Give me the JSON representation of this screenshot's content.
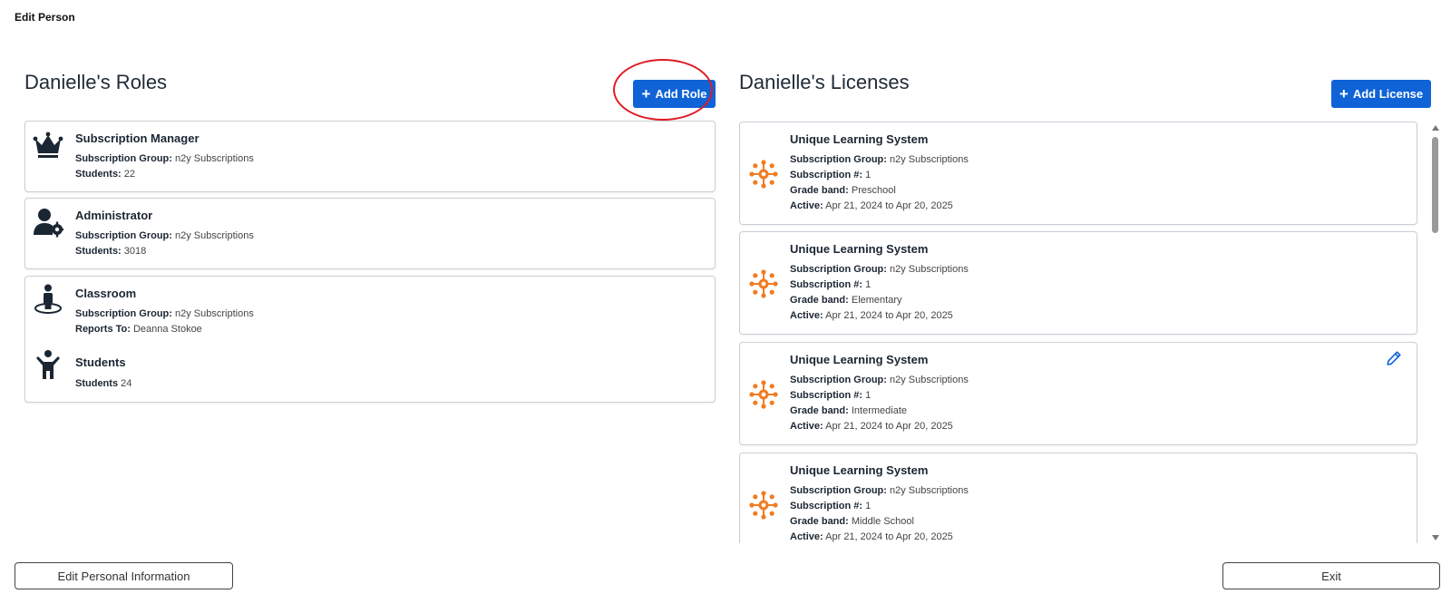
{
  "header": {
    "title": "Edit Person"
  },
  "roles": {
    "title": "Danielle's Roles",
    "add_label": "Add Role",
    "cards": [
      {
        "entries": [
          {
            "icon": "crown-icon",
            "title": "Subscription Manager",
            "lines": [
              {
                "label": "Subscription Group:",
                "value": "n2y Subscriptions"
              },
              {
                "label": "Students:",
                "value": "22"
              }
            ]
          }
        ]
      },
      {
        "entries": [
          {
            "icon": "user-gear-icon",
            "title": "Administrator",
            "lines": [
              {
                "label": "Subscription Group:",
                "value": "n2y Subscriptions"
              },
              {
                "label": "Students:",
                "value": "3018"
              }
            ]
          }
        ]
      },
      {
        "entries": [
          {
            "icon": "person-circle-icon",
            "title": "Classroom",
            "lines": [
              {
                "label": "Subscription Group:",
                "value": "n2y Subscriptions"
              },
              {
                "label": "Reports To:",
                "value": "Deanna Stokoe"
              }
            ]
          },
          {
            "icon": "child-icon",
            "title": "Students",
            "lines": [
              {
                "label": "Students",
                "value": "24"
              }
            ]
          }
        ]
      }
    ]
  },
  "licenses": {
    "title": "Danielle's Licenses",
    "add_label": "Add License",
    "items": [
      {
        "title": "Unique Learning System",
        "lines": [
          {
            "label": "Subscription Group:",
            "value": "n2y Subscriptions"
          },
          {
            "label": "Subscription #:",
            "value": "1"
          },
          {
            "label": "Grade band:",
            "value": "Preschool"
          },
          {
            "label": "Active:",
            "value": "Apr 21, 2024 to Apr 20, 2025"
          }
        ]
      },
      {
        "title": "Unique Learning System",
        "lines": [
          {
            "label": "Subscription Group:",
            "value": "n2y Subscriptions"
          },
          {
            "label": "Subscription #:",
            "value": "1"
          },
          {
            "label": "Grade band:",
            "value": "Elementary"
          },
          {
            "label": "Active:",
            "value": "Apr 21, 2024 to Apr 20, 2025"
          }
        ]
      },
      {
        "title": "Unique Learning System",
        "editable": true,
        "lines": [
          {
            "label": "Subscription Group:",
            "value": "n2y Subscriptions"
          },
          {
            "label": "Subscription #:",
            "value": "1"
          },
          {
            "label": "Grade band:",
            "value": "Intermediate"
          },
          {
            "label": "Active:",
            "value": "Apr 21, 2024 to Apr 20, 2025"
          }
        ]
      },
      {
        "title": "Unique Learning System",
        "lines": [
          {
            "label": "Subscription Group:",
            "value": "n2y Subscriptions"
          },
          {
            "label": "Subscription #:",
            "value": "1"
          },
          {
            "label": "Grade band:",
            "value": "Middle School"
          },
          {
            "label": "Active:",
            "value": "Apr 21, 2024 to Apr 20, 2025"
          }
        ]
      }
    ]
  },
  "footer": {
    "edit_personal_label": "Edit Personal Information",
    "exit_label": "Exit"
  },
  "colors": {
    "primary": "#0f63d6",
    "highlight": "#e01b24",
    "license_icon": "#f07c22",
    "role_icon": "#1b2633"
  }
}
